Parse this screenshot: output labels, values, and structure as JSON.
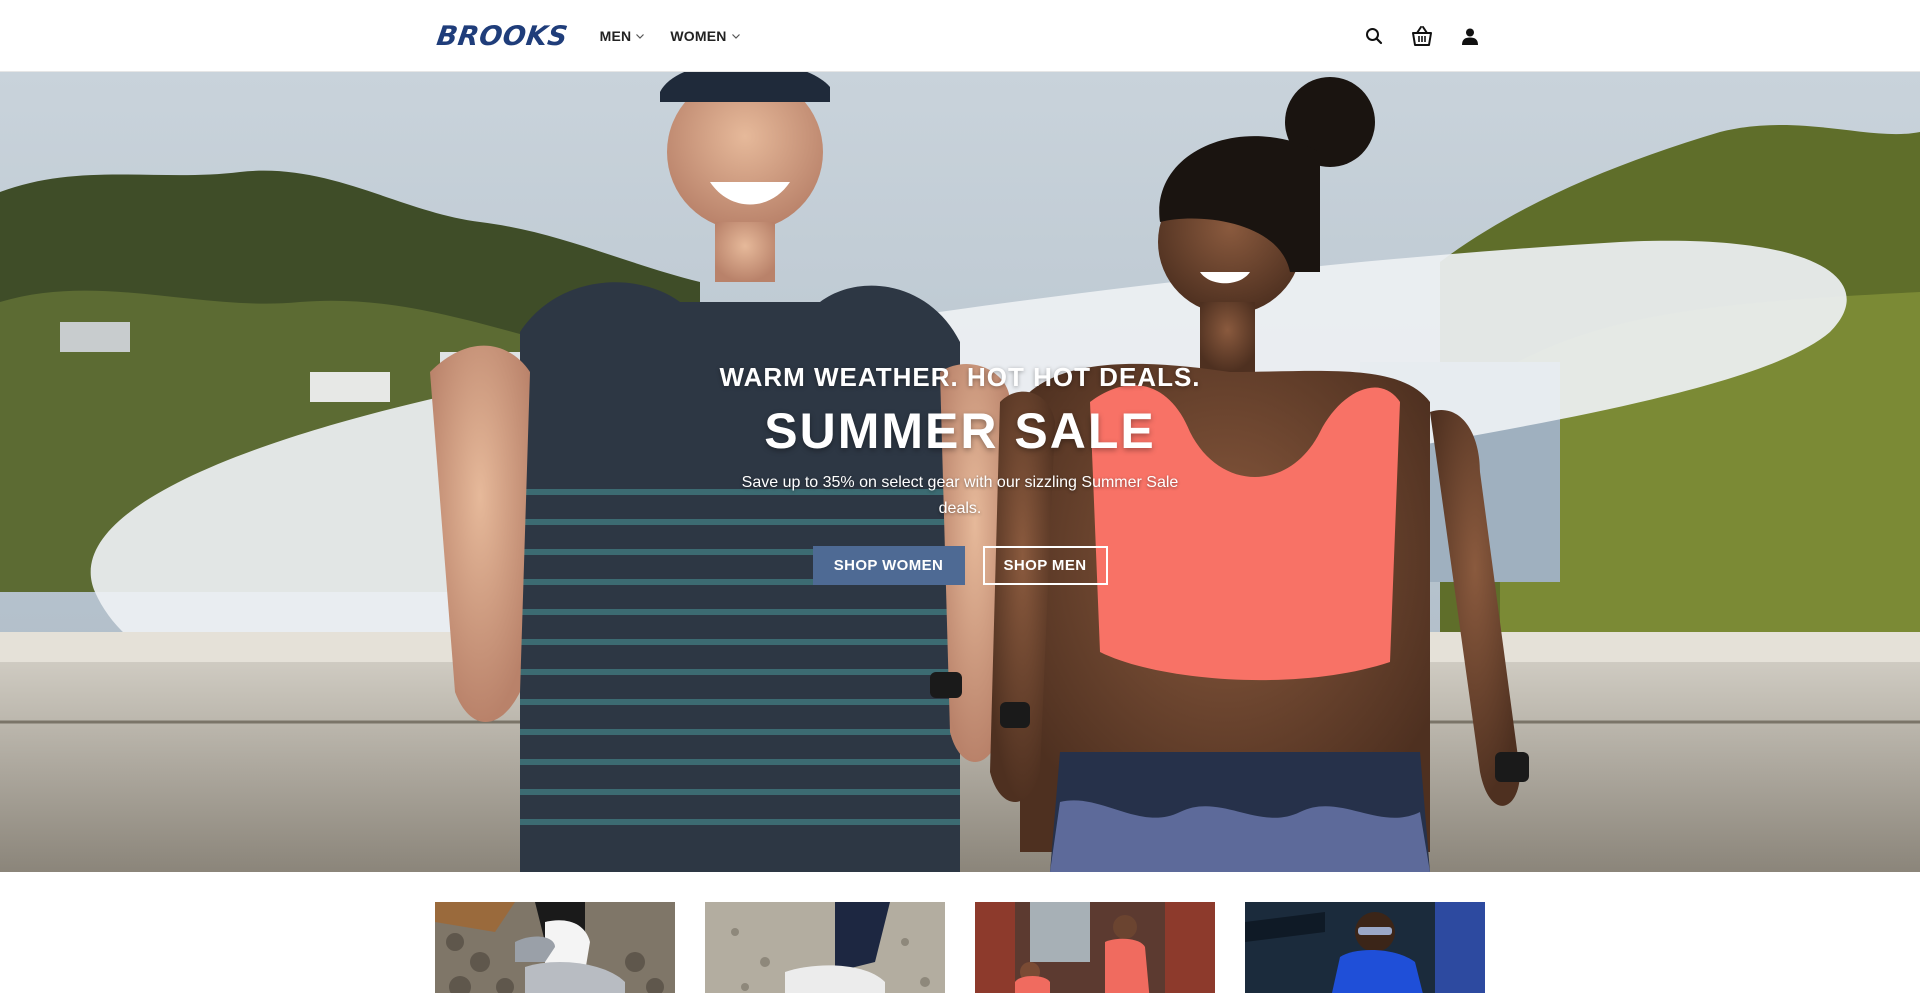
{
  "brand": {
    "logo_text": "BROOKS",
    "color": "#1f3d7a"
  },
  "nav": {
    "items": [
      {
        "label": "MEN",
        "icon": "chevron-down-icon"
      },
      {
        "label": "WOMEN",
        "icon": "chevron-down-icon"
      }
    ]
  },
  "header_icons": [
    "search-icon",
    "basket-icon",
    "user-icon"
  ],
  "hero": {
    "kicker": "WARM WEATHER. HOT HOT DEALS.",
    "title": "SUMMER SALE",
    "description": "Save up to 35% on select gear with our sizzling Summer Sale deals.",
    "primary_button": "SHOP WOMEN",
    "secondary_button": "SHOP MEN",
    "primary_color": "#4e6a94"
  },
  "tiles": [
    {
      "name": "tile-1"
    },
    {
      "name": "tile-2"
    },
    {
      "name": "tile-3"
    },
    {
      "name": "tile-4"
    }
  ]
}
